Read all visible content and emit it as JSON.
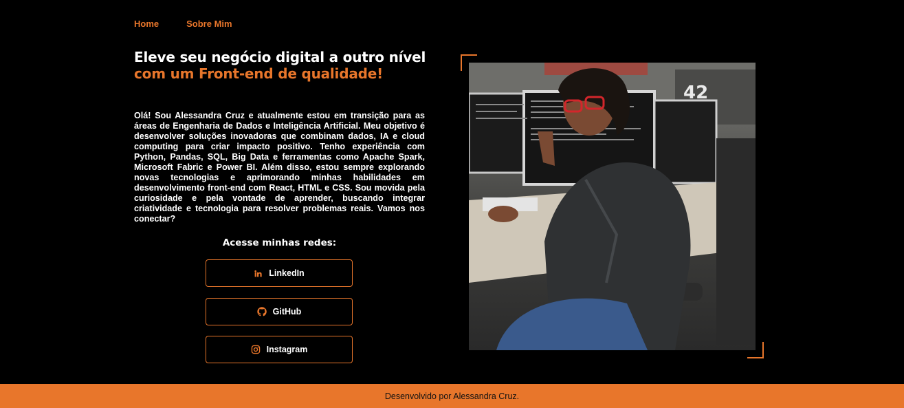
{
  "nav": {
    "items": [
      "Home",
      "Sobre Mim"
    ]
  },
  "hero": {
    "title_part1": "Eleve seu negócio digital a outro nível",
    "title_part2": "com um Front-end de qualidade!",
    "bio": "Olá! Sou Alessandra Cruz e atualmente estou em transição para as áreas de Engenharia de Dados e Inteligência Artificial. Meu objetivo é desenvolver soluções inovadoras que combinam dados, IA e cloud computing para criar impacto positivo. Tenho experiência com Python, Pandas, SQL, Big Data e ferramentas como Apache Spark, Microsoft Fabric e Power BI. Além disso, estou sempre explorando novas tecnologias e aprimorando minhas habilidades em desenvolvimento front-end com React, HTML e CSS. Sou movida pela curiosidade e pela vontade de aprender, buscando integrar criatividade e tecnologia para resolver problemas reais. Vamos nos conectar?"
  },
  "social": {
    "title": "Acesse minhas redes:",
    "linkedin": "LinkedIn",
    "github": "GitHub",
    "instagram": "Instagram"
  },
  "photo": {
    "wall_logo": "42"
  },
  "footer": {
    "text": "Desenvolvido por Alessandra Cruz."
  },
  "colors": {
    "accent": "#e8762b",
    "background": "#000000"
  }
}
